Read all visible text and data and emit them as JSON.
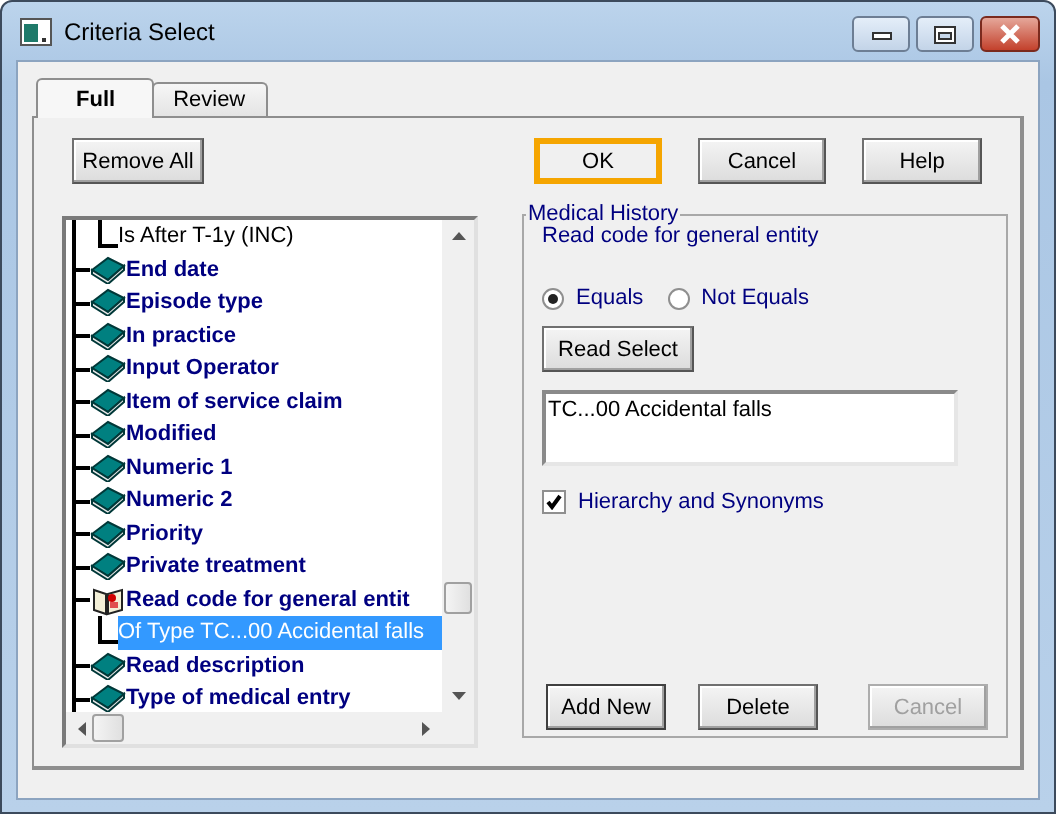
{
  "window": {
    "title": "Criteria Select"
  },
  "tabs": [
    {
      "label": "Full",
      "selected": true
    },
    {
      "label": "Review",
      "selected": false
    }
  ],
  "toolbar": [
    {
      "label": "Remove All",
      "focused": false
    },
    {
      "label": "OK",
      "focused": true
    },
    {
      "label": "Cancel",
      "focused": false
    },
    {
      "label": "Help",
      "focused": false
    }
  ],
  "tree": [
    {
      "kind": "condition",
      "label": "Is After T-1y (INC)",
      "selected": false
    },
    {
      "kind": "criterion",
      "label": "End date",
      "expanded": false,
      "selected": false
    },
    {
      "kind": "criterion",
      "label": "Episode type",
      "expanded": false,
      "selected": false
    },
    {
      "kind": "criterion",
      "label": "In practice",
      "expanded": false,
      "selected": false
    },
    {
      "kind": "criterion",
      "label": "Input Operator",
      "expanded": false,
      "selected": false
    },
    {
      "kind": "criterion",
      "label": "Item of service claim",
      "expanded": false,
      "selected": false
    },
    {
      "kind": "criterion",
      "label": "Modified",
      "expanded": false,
      "selected": false
    },
    {
      "kind": "criterion",
      "label": "Numeric 1",
      "expanded": false,
      "selected": false
    },
    {
      "kind": "criterion",
      "label": "Numeric 2",
      "expanded": false,
      "selected": false
    },
    {
      "kind": "criterion",
      "label": "Priority",
      "expanded": false,
      "selected": false
    },
    {
      "kind": "criterion",
      "label": "Private treatment",
      "expanded": false,
      "selected": false
    },
    {
      "kind": "criterion",
      "label": "Read code for general entit",
      "expanded": true,
      "selected": false,
      "children": [
        {
          "kind": "condition",
          "label": "Of Type TC...00 Accidental falls",
          "selected": true
        }
      ]
    },
    {
      "kind": "criterion",
      "label": "Read description",
      "expanded": false,
      "selected": false
    },
    {
      "kind": "criterion",
      "label": "Type of medical entry",
      "expanded": false,
      "selected": false
    }
  ],
  "group": {
    "title": "Medical History",
    "subtitle": "Read code for general entity",
    "radios": [
      {
        "label": "Equals",
        "selected": true
      },
      {
        "label": "Not Equals",
        "selected": false
      }
    ],
    "read_select_button": "Read Select",
    "codes_field": {
      "value": "TC...00 Accidental falls"
    },
    "checkbox": {
      "label": "Hierarchy and Synonyms",
      "checked": true
    },
    "buttons": [
      {
        "label": "Add New",
        "disabled": false
      },
      {
        "label": "Delete",
        "disabled": false
      },
      {
        "label": "Cancel",
        "disabled": true
      }
    ]
  }
}
